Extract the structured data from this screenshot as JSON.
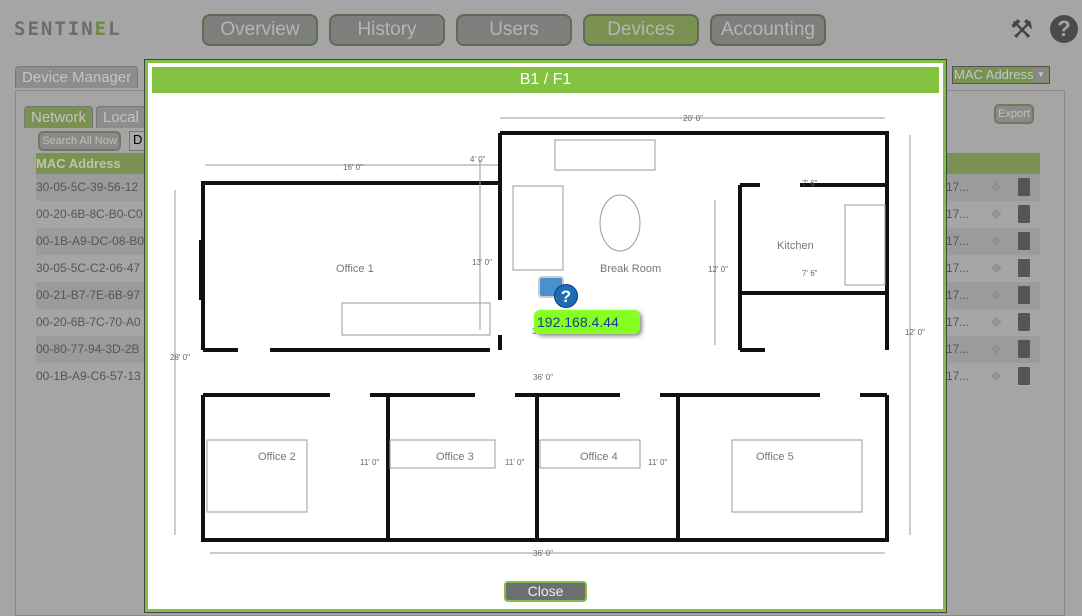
{
  "app": {
    "logo": "SENTINEL",
    "logo_main": "SENTIN",
    "logo_accent": "E",
    "logo_tail": "L"
  },
  "nav": {
    "items": [
      "Overview",
      "History",
      "Users",
      "Devices",
      "Accounting"
    ],
    "active": "Devices"
  },
  "header_icons": [
    "tools-icon",
    "help-icon"
  ],
  "background": {
    "tab": "Device Manager",
    "subtabs": [
      "Network",
      "Local"
    ],
    "search_button": "Search All Now",
    "search_input": "D",
    "filter_select": "MAC Address",
    "export_button": "Export",
    "column_header": "MAC Address",
    "rows": [
      {
        "mac": "30-05-5C-39-56-12",
        "trunc": "17..."
      },
      {
        "mac": "00-20-6B-8C-B0-C0",
        "trunc": "17..."
      },
      {
        "mac": "00-1B-A9-DC-08-B0",
        "trunc": "17..."
      },
      {
        "mac": "30-05-5C-C2-06-47",
        "trunc": "17..."
      },
      {
        "mac": "00-21-B7-7E-6B-97",
        "trunc": "17..."
      },
      {
        "mac": "00-20-6B-7C-70-A0",
        "trunc": "17..."
      },
      {
        "mac": "00-80-77-94-3D-2B",
        "trunc": "17..."
      },
      {
        "mac": "00-1B-A9-C6-57-13",
        "trunc": "17..."
      }
    ]
  },
  "modal": {
    "title": "B1 / F1",
    "close_button": "Close",
    "device": {
      "ip": "192.168.4.44",
      "icon": "printer-unknown-icon"
    },
    "rooms": [
      "Office 1",
      "Break Room",
      "Kitchen",
      "Office 2",
      "Office 3",
      "Office 4",
      "Office 5"
    ],
    "dimensions": [
      "20' 0\"",
      "16' 0\"",
      "4' 0\"",
      "7' 6\"",
      "7' 6\"",
      "13' 0\"",
      "12' 0\"",
      "12' 0\"",
      "28' 0\"",
      "36' 0\"",
      "36' 0\"",
      "11' 0\"",
      "11' 0\"",
      "11' 0\"",
      "30' 0\""
    ]
  },
  "colors": {
    "accent": "#7dc242",
    "title_bar": "#84c341",
    "ip_label": "#88ff22"
  }
}
